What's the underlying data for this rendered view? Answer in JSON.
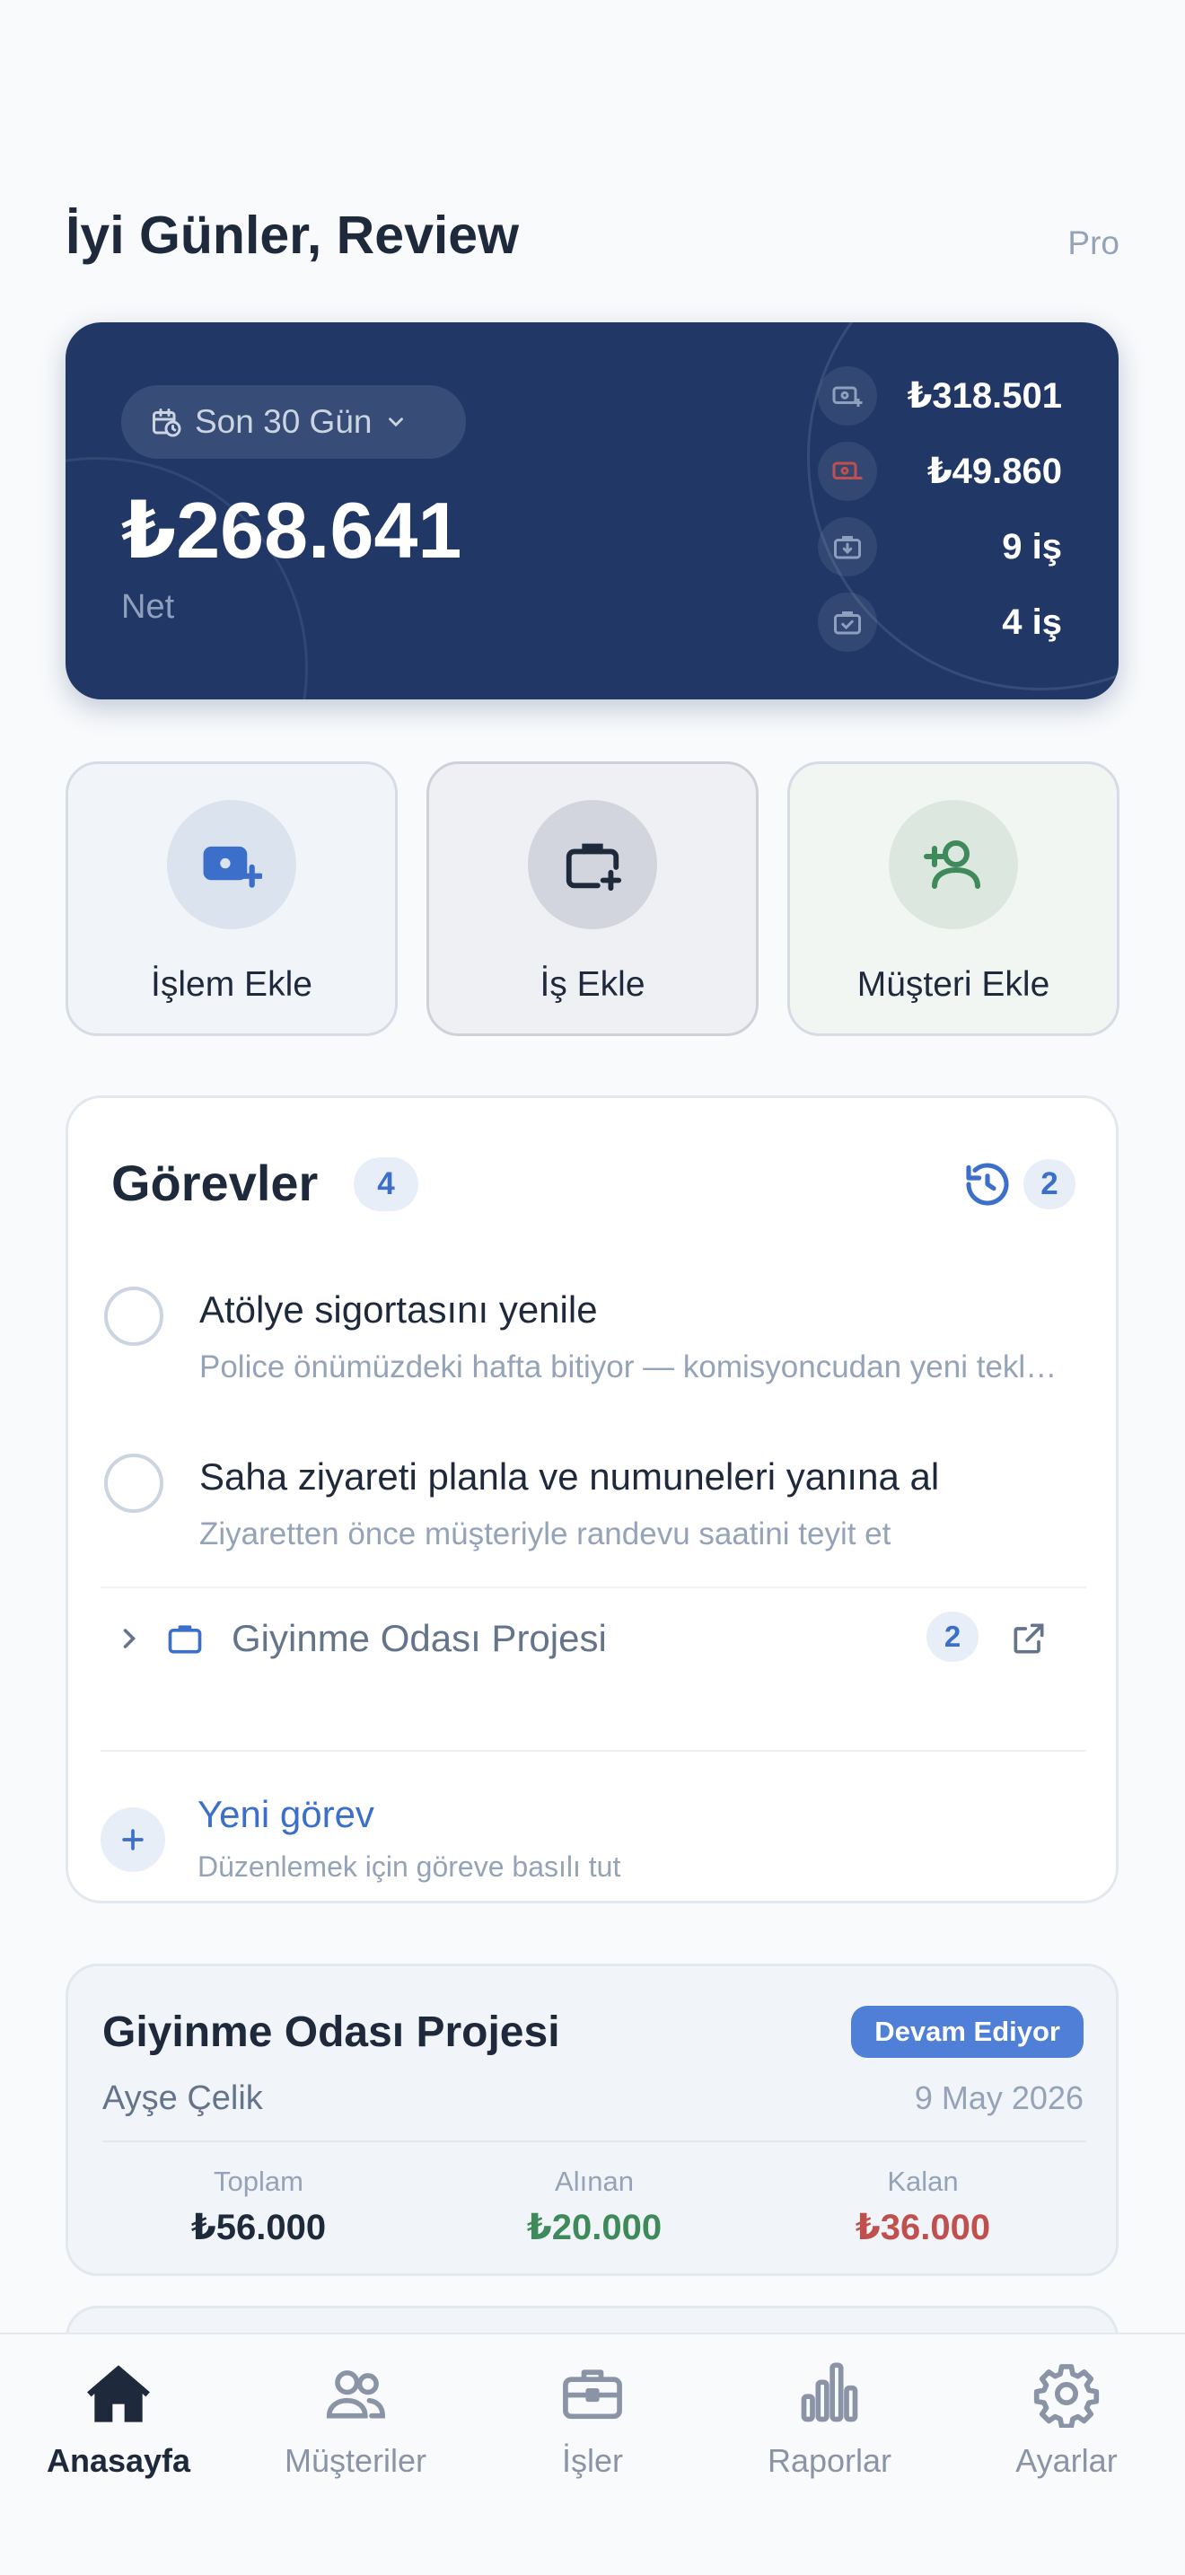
{
  "header": {
    "greeting": "İyi Günler, Review",
    "plan_badge": "Pro"
  },
  "summary": {
    "period_label": "Son 30 Gün",
    "net_value": "₺268.641",
    "net_label": "Net",
    "stats": [
      {
        "icon": "money-plus-icon",
        "value": "₺318.501"
      },
      {
        "icon": "money-minus-icon",
        "value": "₺49.860"
      },
      {
        "icon": "briefcase-download-icon",
        "value": "9 iş"
      },
      {
        "icon": "briefcase-check-icon",
        "value": "4 iş"
      }
    ]
  },
  "quick_actions": [
    {
      "label": "İşlem Ekle",
      "icon": "money-plus-icon"
    },
    {
      "label": "İş Ekle",
      "icon": "briefcase-plus-icon"
    },
    {
      "label": "Müşteri Ekle",
      "icon": "user-plus-icon"
    }
  ],
  "tasks": {
    "title": "Görevler",
    "count": "4",
    "history_count": "2",
    "items": [
      {
        "title": "Atölye sigortasını yenile",
        "subtitle": "Police önümüzdeki hafta bitiyor — komisyoncudan yeni teklif al"
      },
      {
        "title": "Saha ziyareti planla ve numuneleri yanına al",
        "subtitle": "Ziyaretten önce müşteriyle randevu saatini teyit et"
      }
    ],
    "project_group": {
      "name": "Giyinme Odası Projesi",
      "count": "2"
    },
    "new_task": {
      "label": "Yeni görev",
      "hint": "Düzenlemek için göreve basılı tut"
    }
  },
  "project_card": {
    "title": "Giyinme Odası Projesi",
    "status": "Devam Ediyor",
    "client": "Ayşe Çelik",
    "date": "9 May 2026",
    "total_label": "Toplam",
    "total_value": "₺56.000",
    "received_label": "Alınan",
    "received_value": "₺20.000",
    "remaining_label": "Kalan",
    "remaining_value": "₺36.000"
  },
  "nav": [
    {
      "label": "Anasayfa",
      "icon": "home-icon",
      "active": true
    },
    {
      "label": "Müşteriler",
      "icon": "users-icon"
    },
    {
      "label": "İşler",
      "icon": "briefcase-icon"
    },
    {
      "label": "Raporlar",
      "icon": "bar-chart-icon"
    },
    {
      "label": "Ayarlar",
      "icon": "gear-icon"
    }
  ],
  "colors": {
    "accent": "#3b6fc9",
    "card_navy": "#213867",
    "positive": "#3f8a5a",
    "negative": "#c0504d"
  }
}
